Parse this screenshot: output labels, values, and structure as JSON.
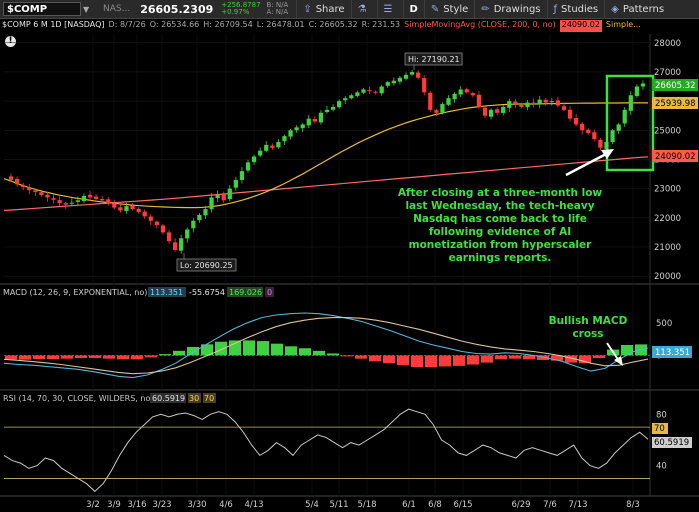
{
  "toolbar": {
    "symbol": "$COMP",
    "exchange": "NAS...",
    "last_price": "26605.2309",
    "change_abs": "+256.8787",
    "change_pct": "+0.97%",
    "bid": "B: N/A",
    "ask": "A: N/A",
    "share_label": "Share",
    "period_label": "D",
    "style_label": "Style",
    "drawings_label": "Drawings",
    "studies_label": "Studies",
    "patterns_label": "Patterns"
  },
  "price_header": {
    "title": "$COMP 6 M 1D [NASDAQ]",
    "date": "D: 8/7/26",
    "open": "O: 26534.66",
    "high": "H: 26709.54",
    "low": "L: 26478.01",
    "close": "C: 26605.32",
    "range": "R: 231.53",
    "sma200_label": "SimpleMovingAvg (CLOSE, 200, 0, no)",
    "sma200_value": "24090.02",
    "sma50_label_trunc": "Simple..."
  },
  "alert_icon": "!",
  "annotations": {
    "hi_label": "Hi: 27190.21",
    "lo_label": "Lo: 20690.25",
    "price_note": [
      "After closing at a three-month low",
      "last Wednesday, the tech-heavy",
      "Nasdaq has come back to life",
      "following evidence of AI",
      "monetization from hyperscaler",
      "earnings reports."
    ],
    "macd_note": [
      "Bullish MACD",
      "cross"
    ]
  },
  "macd_header": {
    "label": "MACD (12, 26, 9, EXPONENTIAL, no)",
    "value": "113.351",
    "avg": "-55.6754",
    "diff": "169.026",
    "zero": "0"
  },
  "rsi_header": {
    "label": "RSI (14, 70, 30, CLOSE, WILDERS, no)",
    "value": "60.5919",
    "ob": "30",
    "os": "70"
  },
  "price_badges": {
    "last": "26605.32",
    "sma50": "25939.98",
    "sma200": "24090.02"
  },
  "macd_badge": "113.351",
  "rsi_badges": {
    "os": "70",
    "value": "60.5919"
  },
  "colors": {
    "up": "#3fd13f",
    "down": "#ff3b3b",
    "sma50": "#e8b93b",
    "sma200": "#ff6b6b",
    "macd_line": "#5ab4d6",
    "macd_signal": "#d8c39a",
    "rsi": "#c8c8c8",
    "annotation": "#3fe03f"
  },
  "chart_data": [
    {
      "type": "candlestick",
      "title": "$COMP 6 M 1D [NASDAQ]",
      "x_tick_labels": [
        "3/2",
        "3/9",
        "3/16",
        "3/23",
        "3/30",
        "4/6",
        "4/13",
        "5/4",
        "5/11",
        "5/18",
        "6/1",
        "6/8",
        "6/15",
        "6/29",
        "7/6",
        "7/13",
        "8/3"
      ],
      "y_tick_labels": [
        "20000",
        "21000",
        "22000",
        "23000",
        "24000",
        "25000",
        "26000",
        "27000",
        "28000"
      ],
      "ylim": [
        19800,
        28300
      ],
      "close": [
        23300,
        23150,
        23050,
        22950,
        22880,
        22780,
        22700,
        22620,
        22500,
        22450,
        22520,
        22600,
        22750,
        22700,
        22650,
        22600,
        22500,
        22350,
        22250,
        22400,
        22300,
        22200,
        22050,
        21900,
        21750,
        21500,
        21200,
        20900,
        21300,
        21600,
        21900,
        22100,
        22300,
        22700,
        22800,
        22600,
        23000,
        23300,
        23600,
        23900,
        24100,
        24300,
        24500,
        24400,
        24600,
        24800,
        25000,
        25100,
        25200,
        25400,
        25300,
        25600,
        25700,
        25800,
        26000,
        26100,
        26200,
        26300,
        26400,
        26350,
        26300,
        26500,
        26650,
        26700,
        26800,
        26900,
        27000,
        26800,
        26300,
        25700,
        25600,
        25900,
        26100,
        26250,
        26400,
        26300,
        26200,
        25800,
        25500,
        25700,
        25600,
        25800,
        26000,
        25900,
        25800,
        25950,
        25900,
        26050,
        25950,
        26000,
        25850,
        25700,
        25400,
        25200,
        25000,
        24900,
        24700,
        24400,
        24600,
        25000,
        25200,
        25700,
        26200,
        26500,
        26605
      ],
      "sma50": [
        23340,
        23250,
        23150,
        23060,
        22980,
        22910,
        22850,
        22790,
        22740,
        22690,
        22650,
        22610,
        22570,
        22540,
        22510,
        22480,
        22455,
        22430,
        22410,
        22395,
        22380,
        22370,
        22360,
        22355,
        22350,
        22350,
        22360,
        22380,
        22420,
        22470,
        22530,
        22600,
        22680,
        22770,
        22870,
        22980,
        23100,
        23230,
        23370,
        23510,
        23660,
        23810,
        23960,
        24110,
        24260,
        24400,
        24540,
        24670,
        24790,
        24910,
        25020,
        25120,
        25220,
        25300,
        25380,
        25450,
        25520,
        25580,
        25640,
        25690,
        25740,
        25780,
        25810,
        25840,
        25860,
        25880,
        25890,
        25900,
        25900,
        25900,
        25905,
        25910,
        25915,
        25920,
        25925,
        25928,
        25930,
        25932,
        25934,
        25935,
        25936,
        25937,
        25938,
        25939,
        25940
      ],
      "sma200": [
        22250,
        22290,
        22330,
        22370,
        22410,
        22450,
        22490,
        22530,
        22570,
        22610,
        22650,
        22700,
        22750,
        22800,
        22850,
        22900,
        22950,
        23000,
        23050,
        23100,
        23150,
        23200,
        23250,
        23300,
        23350,
        23400,
        23450,
        23500,
        23550,
        23600,
        23650,
        23700,
        23750,
        23800,
        23850,
        23900,
        23950,
        24000,
        24050,
        24090
      ],
      "hi": 27190.21,
      "lo": 20690.25,
      "last": 26605.32,
      "sma50_last": 25939.98,
      "sma200_last": 24090.02
    },
    {
      "type": "macd",
      "y_tick_labels": [
        "500",
        "0"
      ],
      "ylim": [
        -500,
        850
      ],
      "macd": [
        -120,
        -140,
        -150,
        -170,
        -190,
        -210,
        -240,
        -280,
        -320,
        -340,
        -300,
        -220,
        -120,
        20,
        150,
        280,
        400,
        500,
        580,
        620,
        640,
        650,
        640,
        610,
        570,
        520,
        450,
        380,
        300,
        220,
        160,
        110,
        60,
        30,
        20,
        40,
        30,
        0,
        -40,
        -90,
        -170,
        -240,
        -200,
        -60,
        60,
        113
      ],
      "signal": [
        -60,
        -75,
        -95,
        -115,
        -140,
        -170,
        -200,
        -230,
        -260,
        -280,
        -270,
        -240,
        -190,
        -110,
        -20,
        70,
        170,
        270,
        360,
        440,
        500,
        540,
        570,
        580,
        580,
        570,
        540,
        500,
        450,
        400,
        340,
        280,
        220,
        170,
        130,
        100,
        80,
        60,
        30,
        -10,
        -60,
        -120,
        -160,
        -150,
        -100,
        -56
      ],
      "histogram": [
        -60,
        -65,
        -55,
        -55,
        -50,
        -40,
        -40,
        -50,
        -60,
        -60,
        -30,
        20,
        70,
        130,
        170,
        210,
        230,
        230,
        220,
        180,
        140,
        110,
        70,
        30,
        -10,
        -50,
        -90,
        -120,
        -150,
        -180,
        -180,
        -170,
        -160,
        -140,
        -110,
        -60,
        -50,
        -60,
        -70,
        -80,
        -110,
        -120,
        -40,
        90,
        160,
        169
      ]
    },
    {
      "type": "rsi",
      "y_tick_labels": [
        "80",
        "40"
      ],
      "ylim": [
        18,
        88
      ],
      "overbought": 70,
      "oversold": 30,
      "rsi": [
        48,
        44,
        42,
        38,
        40,
        46,
        44,
        38,
        34,
        30,
        26,
        20,
        26,
        36,
        48,
        58,
        66,
        72,
        78,
        80,
        78,
        80,
        81,
        79,
        76,
        80,
        82,
        80,
        74,
        66,
        56,
        48,
        52,
        58,
        54,
        48,
        56,
        60,
        64,
        62,
        58,
        54,
        58,
        56,
        60,
        64,
        68,
        74,
        80,
        84,
        82,
        80,
        72,
        60,
        56,
        50,
        48,
        52,
        56,
        54,
        50,
        48,
        46,
        52,
        54,
        52,
        50,
        48,
        52,
        56,
        46,
        40,
        38,
        42,
        50,
        56,
        62,
        66,
        60.59
      ]
    }
  ]
}
